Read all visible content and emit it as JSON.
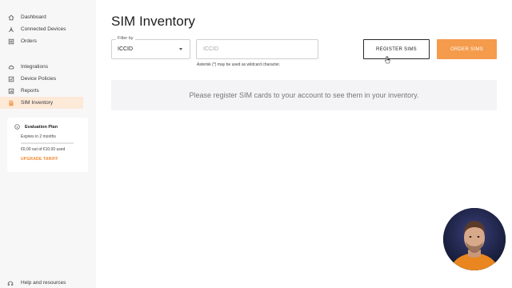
{
  "sidebar": {
    "group1": [
      {
        "label": "Dashboard",
        "icon": "home-icon"
      },
      {
        "label": "Connected Devices",
        "icon": "devices-icon"
      },
      {
        "label": "Orders",
        "icon": "orders-icon"
      }
    ],
    "group2": [
      {
        "label": "Integrations",
        "icon": "cloud-icon"
      },
      {
        "label": "Device Policies",
        "icon": "policy-icon"
      },
      {
        "label": "Reports",
        "icon": "reports-icon"
      },
      {
        "label": "SIM Inventory",
        "icon": "sim-icon",
        "active": true
      }
    ],
    "plan": {
      "title": "Evaluation Plan",
      "expires": "Expires in 2 months",
      "usage": "€0.00 out of €10.00 used",
      "usage_fraction": 0,
      "upgrade": "UPGRADE TARIFF"
    },
    "help": "Help and resources"
  },
  "main": {
    "title": "SIM Inventory",
    "filter": {
      "label": "Filter by",
      "value": "ICCID"
    },
    "search": {
      "placeholder": "ICCID",
      "value": "",
      "hint": "Asterisk (*) may be used as wildcard character."
    },
    "register_label": "REGISTER SIMS",
    "order_label": "ORDER SIMS",
    "empty_message": "Please register SIM cards to your account to see them in your inventory."
  },
  "colors": {
    "accent": "#f59b4c",
    "active_bg": "#fde9d8",
    "sidebar_bg": "#f7f7f8"
  }
}
